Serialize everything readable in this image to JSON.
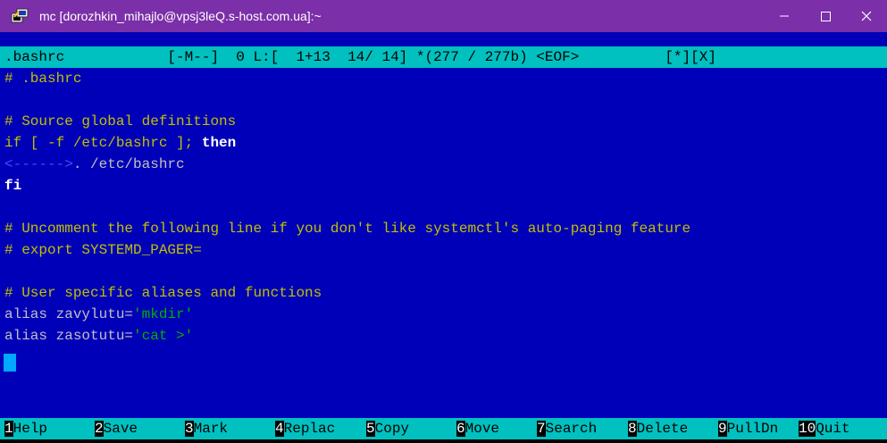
{
  "window": {
    "title": "mc [dorozhkin_mihajlo@vpsj3leQ.s-host.com.ua]:~",
    "icon": "putty-terminal-icon",
    "controls": {
      "minimize": "—",
      "maximize": "☐",
      "close": "✕"
    }
  },
  "editor": {
    "status": ".bashrc            [-M--]  0 L:[  1+13  14/ 14] *(277 / 277b) <EOF>          [*][X]",
    "lines": [
      [
        {
          "t": "# .bashrc",
          "c": "comment"
        }
      ],
      [],
      [
        {
          "t": "# Source global definitions",
          "c": "comment"
        }
      ],
      [
        {
          "t": "if [ -f /etc/bashrc ]; ",
          "c": "comment"
        },
        {
          "t": "then",
          "c": "kw"
        }
      ],
      [
        {
          "t": "<------>",
          "c": "tab"
        },
        {
          "t": ". /etc/bashrc",
          "c": "pre"
        }
      ],
      [
        {
          "t": "fi",
          "c": "kw"
        }
      ],
      [],
      [
        {
          "t": "# Uncomment the following line if you don't like systemctl's auto-paging feature",
          "c": "comment"
        }
      ],
      [
        {
          "t": "# export SYSTEMD_PAGER=",
          "c": "comment"
        }
      ],
      [],
      [
        {
          "t": "# User specific aliases and functions",
          "c": "comment"
        }
      ],
      [
        {
          "t": "alias zavylutu=",
          "c": "pre"
        },
        {
          "t": "'mkdir'",
          "c": "str"
        }
      ],
      [
        {
          "t": "alias zasotutu=",
          "c": "pre"
        },
        {
          "t": "'cat >'",
          "c": "str"
        }
      ]
    ]
  },
  "function_keys": [
    {
      "num": "1",
      "label": "Help"
    },
    {
      "num": "2",
      "label": "Save"
    },
    {
      "num": "3",
      "label": "Mark"
    },
    {
      "num": "4",
      "label": "Replac"
    },
    {
      "num": "5",
      "label": "Copy"
    },
    {
      "num": "6",
      "label": "Move"
    },
    {
      "num": "7",
      "label": "Search"
    },
    {
      "num": "8",
      "label": "Delete"
    },
    {
      "num": "9",
      "label": "PullDn"
    },
    {
      "num": "10",
      "label": "Quit"
    }
  ],
  "colors": {
    "titlebar": "#7b2fa8",
    "editor_bg": "#0000b8",
    "bar_cyan": "#00c0c0",
    "comment": "#c0c000",
    "string": "#00b000",
    "cursor": "#00a8ff"
  }
}
